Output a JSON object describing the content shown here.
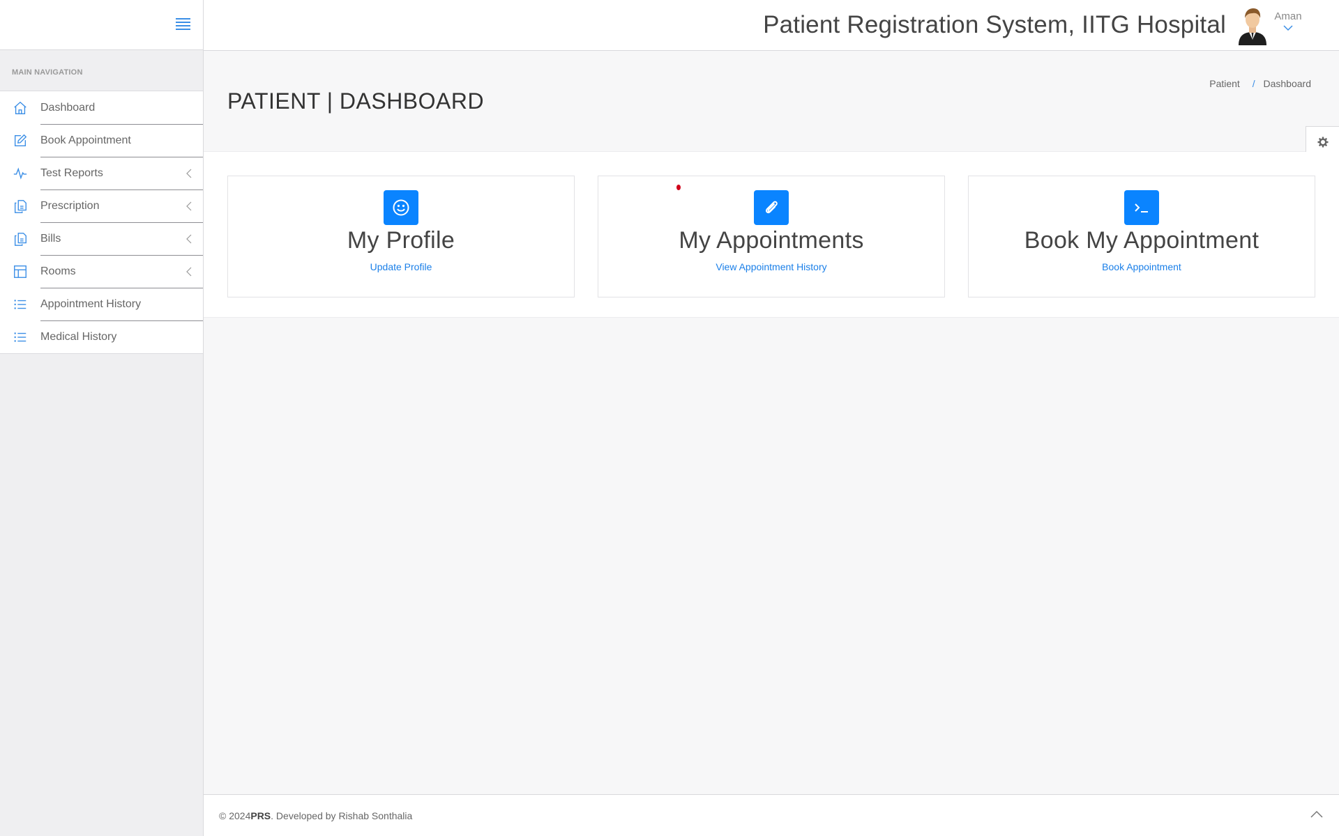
{
  "header": {
    "title": "Patient Registration System, IITG Hospital",
    "user_name": "Aman"
  },
  "sidebar": {
    "heading": "MAIN NAVIGATION",
    "items": [
      {
        "label": "Dashboard",
        "icon": "home-icon",
        "submenu": false
      },
      {
        "label": "Book Appointment",
        "icon": "edit-icon",
        "submenu": false
      },
      {
        "label": "Test Reports",
        "icon": "pulse-icon",
        "submenu": true
      },
      {
        "label": "Prescription",
        "icon": "files-icon",
        "submenu": true
      },
      {
        "label": "Bills",
        "icon": "files-icon",
        "submenu": true
      },
      {
        "label": "Rooms",
        "icon": "layout-icon",
        "submenu": true
      },
      {
        "label": "Appointment History",
        "icon": "list-icon",
        "submenu": false
      },
      {
        "label": "Medical History",
        "icon": "list-icon",
        "submenu": false
      }
    ]
  },
  "page": {
    "title": "PATIENT | DASHBOARD",
    "breadcrumb": [
      "Patient",
      "Dashboard"
    ]
  },
  "cards": [
    {
      "title": "My Profile",
      "link": "Update Profile",
      "icon": "smile-icon"
    },
    {
      "title": "My Appointments",
      "link": "View Appointment History",
      "icon": "paperclip-icon"
    },
    {
      "title": "Book My Appointment",
      "link": "Book Appointment",
      "icon": "terminal-icon"
    }
  ],
  "footer": {
    "prefix": "© 2024 ",
    "brand": "PRS",
    "suffix": ". Developed by Rishab Sonthalia"
  },
  "colors": {
    "accent": "#0a84ff",
    "link": "#1a7fe8",
    "icon_blue": "#3a8ee6"
  }
}
